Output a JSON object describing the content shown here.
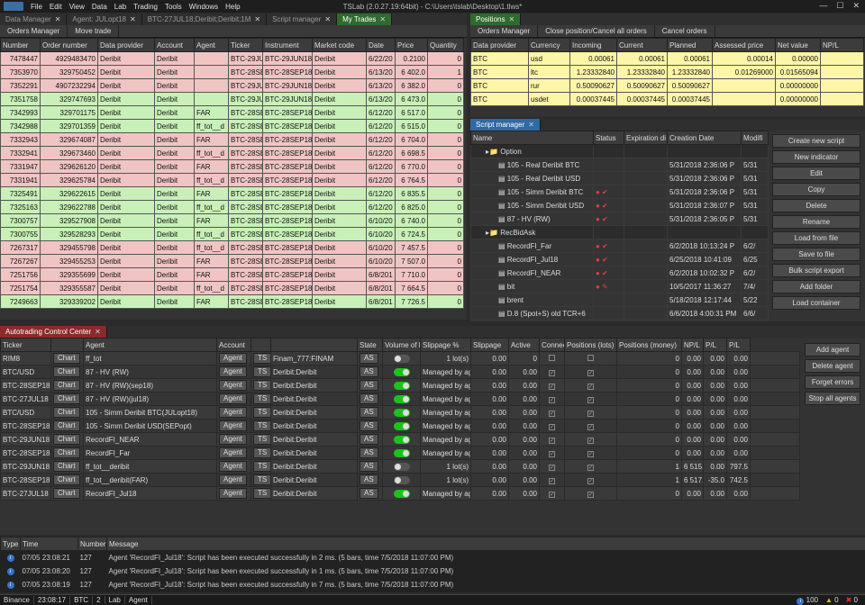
{
  "app": {
    "title": "TSLab (2.0.27.19:64bit) - C:\\Users\\tslab\\Desktop\\1.tlws*",
    "menu": [
      "File",
      "Edit",
      "View",
      "Data",
      "Lab",
      "Trading",
      "Tools",
      "Windows",
      "Help"
    ]
  },
  "left_tabs": [
    "Data Manager",
    "Agent: JULopt18",
    "BTC-27JUL18;Deribit;Deribit;1M",
    "Script manager",
    "My Trades"
  ],
  "left_toolbar": [
    "Orders Manager",
    "Move trade"
  ],
  "trades": {
    "columns": [
      "Number",
      "Order number",
      "Data provider",
      "Account",
      "Agent",
      "Ticker",
      "Instrument",
      "Market code",
      "Date",
      "Price",
      "Quantity"
    ],
    "rows": [
      {
        "c": "pink",
        "v": [
          "7478447",
          "4929483470",
          "Deribit",
          "Deribit",
          "",
          "BTC-29JU",
          "BTC-29JUN18-",
          "Deribit",
          "6/22/20",
          "0.2100",
          "0"
        ]
      },
      {
        "c": "pink",
        "v": [
          "7353970",
          "329750452",
          "Deribit",
          "Deribit",
          "",
          "BTC-28SE",
          "BTC-28SEP18",
          "Deribit",
          "6/13/20",
          "6 402.0",
          "1"
        ]
      },
      {
        "c": "pink",
        "v": [
          "7352291",
          "4907232294",
          "Deribit",
          "Deribit",
          "",
          "BTC-29JU",
          "BTC-29JUN18",
          "Deribit",
          "6/13/20",
          "6 382.0",
          "0"
        ]
      },
      {
        "c": "green",
        "v": [
          "7351758",
          "329747693",
          "Deribit",
          "Deribit",
          "",
          "BTC-29JU",
          "BTC-29JUN18",
          "Deribit",
          "6/13/20",
          "6 473.0",
          "0"
        ]
      },
      {
        "c": "green",
        "v": [
          "7342993",
          "329701175",
          "Deribit",
          "Deribit",
          "FAR",
          "BTC-28SE",
          "BTC-28SEP18",
          "Deribit",
          "6/12/20",
          "6 517.0",
          "0"
        ]
      },
      {
        "c": "green",
        "v": [
          "7342988",
          "329701359",
          "Deribit",
          "Deribit",
          "ff_tot__d",
          "BTC-28SE",
          "BTC-28SEP18",
          "Deribit",
          "6/12/20",
          "6 515.0",
          "0"
        ]
      },
      {
        "c": "pink",
        "v": [
          "7332943",
          "329674087",
          "Deribit",
          "Deribit",
          "FAR",
          "BTC-28SE",
          "BTC-28SEP18",
          "Deribit",
          "6/12/20",
          "6 704.0",
          "0"
        ]
      },
      {
        "c": "pink",
        "v": [
          "7332941",
          "329673460",
          "Deribit",
          "Deribit",
          "ff_tot__d",
          "BTC-28SE",
          "BTC-28SEP18",
          "Deribit",
          "6/12/20",
          "6 698.5",
          "0"
        ]
      },
      {
        "c": "pink",
        "v": [
          "7331947",
          "329626120",
          "Deribit",
          "Deribit",
          "FAR",
          "BTC-28SE",
          "BTC-28SEP18",
          "Deribit",
          "6/12/20",
          "6 770.0",
          "0"
        ]
      },
      {
        "c": "pink",
        "v": [
          "7331941",
          "329625784",
          "Deribit",
          "Deribit",
          "ff_tot__d",
          "BTC-28SE",
          "BTC-28SEP18",
          "Deribit",
          "6/12/20",
          "6 764.5",
          "0"
        ]
      },
      {
        "c": "green",
        "v": [
          "7325491",
          "329622615",
          "Deribit",
          "Deribit",
          "FAR",
          "BTC-28SE",
          "BTC-28SEP18",
          "Deribit",
          "6/12/20",
          "6 835.5",
          "0"
        ]
      },
      {
        "c": "green",
        "v": [
          "7325163",
          "329622788",
          "Deribit",
          "Deribit",
          "ff_tot__d",
          "BTC-28SE",
          "BTC-28SEP18",
          "Deribit",
          "6/12/20",
          "6 825.0",
          "0"
        ]
      },
      {
        "c": "green",
        "v": [
          "7300757",
          "329527908",
          "Deribit",
          "Deribit",
          "FAR",
          "BTC-28SE",
          "BTC-28SEP18",
          "Deribit",
          "6/10/20",
          "6 740.0",
          "0"
        ]
      },
      {
        "c": "green",
        "v": [
          "7300755",
          "329528293",
          "Deribit",
          "Deribit",
          "ff_tot__d",
          "BTC-28SE",
          "BTC-28SEP18",
          "Deribit",
          "6/10/20",
          "6 724.5",
          "0"
        ]
      },
      {
        "c": "pink",
        "v": [
          "7267317",
          "329455798",
          "Deribit",
          "Deribit",
          "ff_tot__d",
          "BTC-28SE",
          "BTC-28SEP18",
          "Deribit",
          "6/10/20",
          "7 457.5",
          "0"
        ]
      },
      {
        "c": "pink",
        "v": [
          "7267267",
          "329455253",
          "Deribit",
          "Deribit",
          "FAR",
          "BTC-28SE",
          "BTC-28SEP18",
          "Deribit",
          "6/10/20",
          "7 507.0",
          "0"
        ]
      },
      {
        "c": "pink",
        "v": [
          "7251756",
          "329355699",
          "Deribit",
          "Deribit",
          "FAR",
          "BTC-28SE",
          "BTC-28SEP18",
          "Deribit",
          "6/8/201",
          "7 710.0",
          "0"
        ]
      },
      {
        "c": "pink",
        "v": [
          "7251754",
          "329355587",
          "Deribit",
          "Deribit",
          "ff_tot__d",
          "BTC-28SE",
          "BTC-28SEP18",
          "Deribit",
          "6/8/201",
          "7 664.5",
          "0"
        ]
      },
      {
        "c": "green",
        "v": [
          "7249663",
          "329339202",
          "Deribit",
          "Deribit",
          "FAR",
          "BTC-28SE",
          "BTC-28SEP18",
          "Deribit",
          "6/8/201",
          "7 726.5",
          "0"
        ]
      }
    ]
  },
  "positions": {
    "tab": "Positions",
    "toolbar": [
      "Orders Manager",
      "Close position/Cancel all orders",
      "Cancel orders"
    ],
    "columns": [
      "Data provider",
      "Currency",
      "Incoming",
      "Current",
      "Planned",
      "Assessed price",
      "Net value",
      "NP/L"
    ],
    "rows": [
      [
        "BTC",
        "usd",
        "0.00061",
        "0.00061",
        "0.00061",
        "0.00014",
        "0.00000",
        ""
      ],
      [
        "BTC",
        "ltc",
        "1.23332840",
        "1.23332840",
        "1.23332840",
        "0.01269000",
        "0.01565094",
        ""
      ],
      [
        "BTC",
        "rur",
        "0.50090627",
        "0.50090627",
        "0.50090627",
        "",
        "0.00000000",
        ""
      ],
      [
        "BTC",
        "usdet",
        "0.00037445",
        "0.00037445",
        "0.00037445",
        "",
        "0.00000000",
        ""
      ]
    ]
  },
  "script_manager": {
    "tab": "Script manager",
    "columns": [
      "Name",
      "Status",
      "Expiration di",
      "Creation Date",
      "Modifi"
    ],
    "rows": [
      {
        "t": "grp",
        "n": "Option",
        "s": "",
        "e": "",
        "d": "",
        "m": ""
      },
      {
        "t": "item",
        "n": "105 - Real Deribit BTC",
        "s": "",
        "e": "",
        "d": "5/31/2018 2:36:06 P",
        "m": "5/31"
      },
      {
        "t": "item",
        "n": "105 - Real Deribit USD",
        "s": "",
        "e": "",
        "d": "5/31/2018 2:36:06 P",
        "m": "5/31"
      },
      {
        "t": "item",
        "n": "105 - Simm Deribit BTC",
        "s": "● ✔",
        "e": "",
        "d": "5/31/2018 2:36:06 P",
        "m": "5/31"
      },
      {
        "t": "item",
        "n": "105 - Simm Deribit USD",
        "s": "● ✔",
        "e": "",
        "d": "5/31/2018 2:36:07 P",
        "m": "5/31"
      },
      {
        "t": "item",
        "n": "87 - HV (RW)",
        "s": "● ✔",
        "e": "",
        "d": "5/31/2018 2:36:05 P",
        "m": "5/31"
      },
      {
        "t": "grp",
        "n": "RecBidAsk",
        "s": "",
        "e": "",
        "d": "",
        "m": ""
      },
      {
        "t": "item",
        "n": "RecordFI_Far",
        "s": "● ✔",
        "e": "",
        "d": "6/2/2018 10:13:24 P",
        "m": "6/2/"
      },
      {
        "t": "item",
        "n": "RecordFI_Jul18",
        "s": "● ✔",
        "e": "",
        "d": "6/25/2018 10:41:09",
        "m": "6/25"
      },
      {
        "t": "item",
        "n": "RecordFI_NEAR",
        "s": "● ✔",
        "e": "",
        "d": "6/2/2018 10:02:32 P",
        "m": "6/2/"
      },
      {
        "t": "item",
        "n": "bit",
        "s": "● ✎",
        "e": "",
        "d": "10/5/2017 11:36:27",
        "m": "7/4/"
      },
      {
        "t": "item",
        "n": "brent",
        "s": "",
        "e": "",
        "d": "5/18/2018 12:17:44",
        "m": "5/22"
      },
      {
        "t": "item",
        "n": "D.8 (Spot+S) old TCR+6",
        "s": "",
        "e": "",
        "d": "6/6/2018 4:00:31 PM",
        "m": "6/6/"
      }
    ],
    "buttons": [
      "Create new script",
      "New indicator",
      "Edit",
      "Copy",
      "Delete",
      "Rename",
      "Load from file",
      "Save to file",
      "Bulk script export",
      "Add folder",
      "Load container"
    ]
  },
  "act": {
    "tab": "Autotrading Control Center",
    "columns": [
      "Ticker",
      "Agent",
      "Account",
      "State",
      "Volume of limit",
      "Slippage %",
      "Slippage",
      "Active",
      "Connected",
      "Positions (lots)",
      "Positions (money)",
      "NP/L",
      "P/L",
      "P/L"
    ],
    "rows": [
      {
        "tk": "RIM8",
        "ag": "ff_tot",
        "ac": "Finam_777:FINAM",
        "on": false,
        "vol": "1 lot(s)",
        "sp": "0.00",
        "sl": "0",
        "act": false,
        "con": false,
        "pl": "0",
        "pm": "0.00",
        "np": "0.00",
        "p1": "0.00"
      },
      {
        "tk": "BTC/USD",
        "ag": "87 - HV (RW)",
        "ac": "Deribit:Deribit",
        "on": true,
        "vol": "Managed by agent",
        "sp": "0.00",
        "sl": "0.00",
        "act": true,
        "con": true,
        "pl": "0",
        "pm": "0.00",
        "np": "0.00",
        "p1": "0.00"
      },
      {
        "tk": "BTC-28SEP18",
        "ag": "87 - HV (RW)(sep18)",
        "ac": "Deribit:Deribit",
        "on": true,
        "vol": "Managed by agent",
        "sp": "0.00",
        "sl": "0.00",
        "act": true,
        "con": true,
        "pl": "0",
        "pm": "0.00",
        "np": "0.00",
        "p1": "0.00"
      },
      {
        "tk": "BTC-27JUL18",
        "ag": "87 - HV (RW)(jul18)",
        "ac": "Deribit:Deribit",
        "on": true,
        "vol": "Managed by agent",
        "sp": "0.00",
        "sl": "0.00",
        "act": true,
        "con": true,
        "pl": "0",
        "pm": "0.00",
        "np": "0.00",
        "p1": "0.00"
      },
      {
        "tk": "BTC/USD",
        "ag": "105 - Simm Deribit BTC(JULopt18)",
        "ac": "Deribit:Deribit",
        "on": true,
        "vol": "Managed by agent",
        "sp": "0.00",
        "sl": "0.00",
        "act": true,
        "con": true,
        "pl": "0",
        "pm": "0.00",
        "np": "0.00",
        "p1": "0.00"
      },
      {
        "tk": "BTC-28SEP18",
        "ag": "105 - Simm Deribit USD(SEPopt)",
        "ac": "Deribit:Deribit",
        "on": true,
        "vol": "Managed by agent",
        "sp": "0.00",
        "sl": "0.00",
        "act": true,
        "con": true,
        "pl": "0",
        "pm": "0.00",
        "np": "0.00",
        "p1": "0.00"
      },
      {
        "tk": "BTC-29JUN18",
        "ag": "RecordFI_NEAR",
        "ac": "Deribit:Deribit",
        "on": true,
        "vol": "Managed by agent",
        "sp": "0.00",
        "sl": "0.00",
        "act": true,
        "con": true,
        "pl": "0",
        "pm": "0.00",
        "np": "0.00",
        "p1": "0.00"
      },
      {
        "tk": "BTC-28SEP18",
        "ag": "RecordFI_Far",
        "ac": "Deribit:Deribit",
        "on": true,
        "vol": "Managed by agent",
        "sp": "0.00",
        "sl": "0.00",
        "act": true,
        "con": true,
        "pl": "0",
        "pm": "0.00",
        "np": "0.00",
        "p1": "0.00"
      },
      {
        "tk": "BTC-29JUN18",
        "ag": "ff_tot__deribit",
        "ac": "Deribit:Deribit",
        "on": false,
        "vol": "1 lot(s)",
        "sp": "0.00",
        "sl": "0.00",
        "act": true,
        "con": true,
        "pl": "1",
        "pm": "6 515.00",
        "np": "0.00",
        "p1": "797.5"
      },
      {
        "tk": "BTC-28SEP18",
        "ag": "ff_tot__deribit(FAR)",
        "ac": "Deribit:Deribit",
        "on": false,
        "vol": "1 lot(s)",
        "sp": "0.00",
        "sl": "0.00",
        "act": true,
        "con": true,
        "pl": "1",
        "pm": "6 517.00",
        "np": "-35.0",
        "p1": "742.5"
      },
      {
        "tk": "BTC-27JUL18",
        "ag": "RecordFI_Jul18",
        "ac": "Deribit:Deribit",
        "on": true,
        "vol": "Managed by agent",
        "sp": "0.00",
        "sl": "0.00",
        "act": true,
        "con": true,
        "pl": "0",
        "pm": "0.00",
        "np": "0.00",
        "p1": "0.00"
      }
    ],
    "chart_label": "Chart",
    "agent_label": "Agent",
    "ts_label": "TS",
    "as_label": "AS",
    "buttons": [
      "Add agent",
      "Delete agent",
      "Forget errors",
      "Stop all agents"
    ]
  },
  "log": {
    "columns": [
      "Type",
      "Time",
      "Number",
      "Message"
    ],
    "rows": [
      [
        "07/05 23:08:21",
        "127",
        "Agent 'RecordFI_Jul18': Script has been executed successfully in 2 ms. (5 bars, time 7/5/2018 11:07:00 PM)"
      ],
      [
        "07/05 23:08:20",
        "127",
        "Agent 'RecordFI_Jul18': Script has been executed successfully in 1 ms. (5 bars, time 7/5/2018 11:07:00 PM)"
      ],
      [
        "07/05 23:08:19",
        "127",
        "Agent 'RecordFI_Jul18': Script has been executed successfully in 7 ms. (5 bars, time 7/5/2018 11:07:00 PM)"
      ]
    ]
  },
  "status": {
    "items": [
      "Binance",
      "23:08:17",
      "BTC",
      "2",
      "Lab",
      "Agent"
    ],
    "info": "100",
    "warn": "0",
    "err": "0"
  }
}
